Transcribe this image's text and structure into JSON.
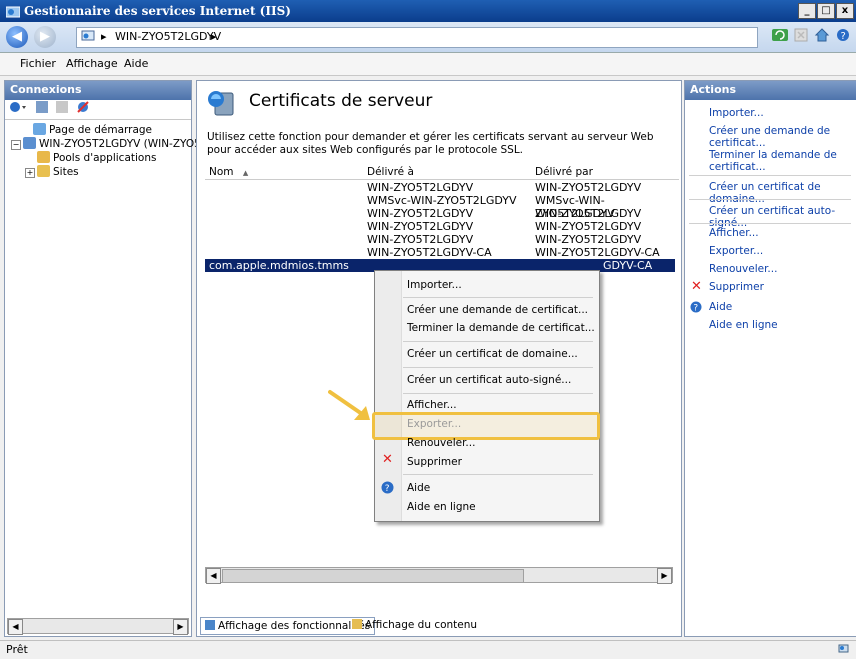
{
  "window": {
    "title": "Gestionnaire des services Internet (IIS)",
    "minimize": "_",
    "restore": "□",
    "close": "x"
  },
  "address": {
    "path": "WIN-ZYO5T2LGDYV",
    "separator": "▸"
  },
  "menu": {
    "items": [
      "Fichier",
      "Affichage",
      "Aide"
    ]
  },
  "connections": {
    "header": "Connexions",
    "tree": [
      {
        "label": "Page de démarrage",
        "icon": "start-page-icon"
      },
      {
        "label": "WIN-ZYO5T2LGDYV (WIN-ZYO5T",
        "icon": "server-icon",
        "expander": "−"
      },
      {
        "label": "Pools d'applications",
        "icon": "app-pool-icon"
      },
      {
        "label": "Sites",
        "icon": "sites-icon",
        "expander": "+"
      }
    ]
  },
  "main": {
    "title": "Certificats de serveur",
    "description": "Utilisez cette fonction pour demander et gérer les certificats servant au serveur Web pour accéder aux sites Web configurés par le protocole SSL.",
    "columns": [
      "Nom",
      "Délivré à",
      "Délivré par"
    ],
    "sort_indicator": "▲",
    "rows": [
      [
        "",
        "WIN-ZYO5T2LGDYV",
        "WIN-ZYO5T2LGDYV"
      ],
      [
        "",
        "WMSvc-WIN-ZYO5T2LGDYV",
        "WMSvc-WIN-ZYO5T2LGDYV"
      ],
      [
        "",
        "WIN-ZYO5T2LGDYV",
        "WIN-ZYO5T2LGDYV"
      ],
      [
        "",
        "WIN-ZYO5T2LGDYV",
        "WIN-ZYO5T2LGDYV"
      ],
      [
        "",
        "WIN-ZYO5T2LGDYV",
        "WIN-ZYO5T2LGDYV"
      ],
      [
        "",
        "WIN-ZYO5T2LGDYV-CA",
        "WIN-ZYO5T2LGDYV-CA"
      ],
      [
        "com.apple.mdmios.tmms",
        "",
        "GDYV-CA"
      ]
    ],
    "selected_row_index": 6,
    "view_tabs": {
      "features": "Affichage des fonctionnalités",
      "content": "Affichage du contenu"
    }
  },
  "context_menu": {
    "items": [
      {
        "label": "Importer...",
        "enabled": true
      },
      {
        "label": "Créer une demande de certificat...",
        "enabled": true
      },
      {
        "label": "Terminer la demande de certificat...",
        "enabled": true
      },
      {
        "label": "Créer un certificat de domaine...",
        "enabled": true
      },
      {
        "label": "Créer un certificat auto-signé...",
        "enabled": true
      },
      {
        "label": "Afficher...",
        "enabled": true
      },
      {
        "label": "Exporter...",
        "enabled": false,
        "highlighted": true
      },
      {
        "label": "Renouveler...",
        "enabled": true
      },
      {
        "label": "Supprimer",
        "enabled": true,
        "icon": "delete-icon"
      },
      {
        "label": "Aide",
        "enabled": true,
        "icon": "help-icon"
      },
      {
        "label": "Aide en ligne",
        "enabled": true
      }
    ]
  },
  "actions": {
    "header": "Actions",
    "items": [
      "Importer...",
      "Créer une demande de certificat...",
      "Terminer la demande de certificat...",
      "Créer un certificat de domaine...",
      "Créer un certificat auto-signé...",
      "Afficher...",
      "Exporter...",
      "Renouveler...",
      "Supprimer",
      "Aide",
      "Aide en ligne"
    ]
  },
  "status": {
    "text": "Prêt"
  },
  "colors": {
    "highlight": "#f0c040",
    "selection": "#0a246a",
    "link": "#0c3fa8"
  }
}
